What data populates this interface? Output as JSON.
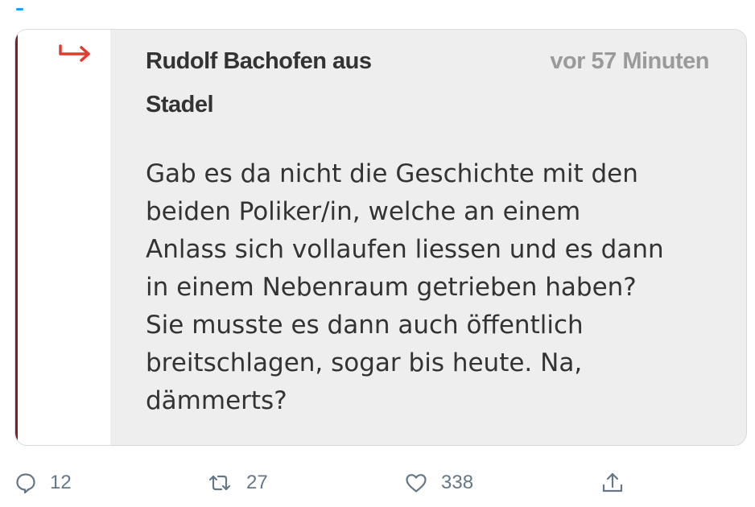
{
  "comment_card": {
    "author": "Rudolf Bachofen aus\nStadel",
    "timestamp": "vor 57 Minuten",
    "text": "Gab es da nicht die Geschichte mit den\nbeiden Poliker/in, welche an einem\nAnlass sich vollaufen liessen und es dann\nin einem Nebenraum getrieben haben?\nSie musste es dann auch öffentlich\nbreitschlagen, sogar bis heute. Na,\ndämmerts?",
    "reply_indicator_icon": "reply-arrow-icon",
    "accent_color": "#e23b2e",
    "left_border_color": "#8a1b1b"
  },
  "tweet_actions": {
    "reply": {
      "icon": "comment-icon",
      "count": "12"
    },
    "retweet": {
      "icon": "retweet-icon",
      "count": "27"
    },
    "like": {
      "icon": "heart-icon",
      "count": "338"
    },
    "share": {
      "icon": "share-icon"
    }
  }
}
